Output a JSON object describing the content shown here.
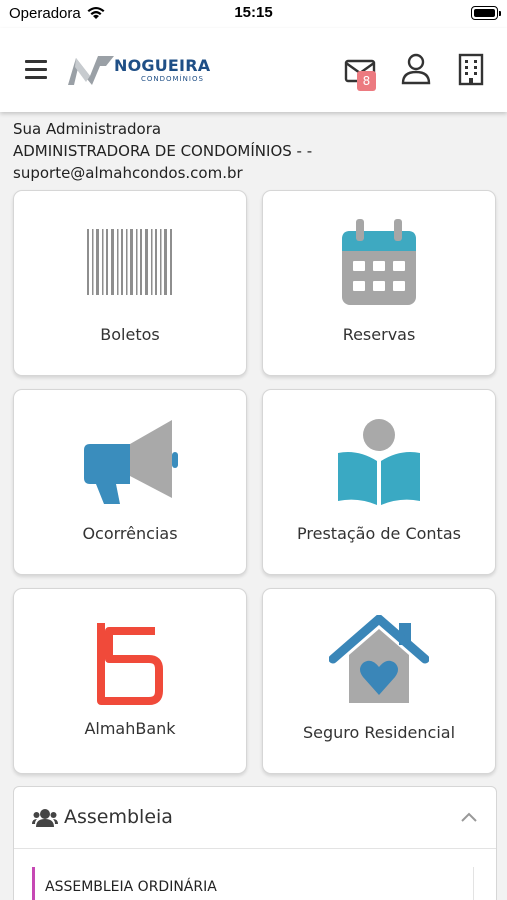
{
  "status_bar": {
    "carrier": "Operadora",
    "time": "15:15"
  },
  "header": {
    "logo_name": "NOGUEIRA",
    "logo_tagline": "CONDOMÍNIOS",
    "mail_badge_count": "8"
  },
  "admin": {
    "heading": "Sua Administradora",
    "name": "ADMINISTRADORA DE CONDOMÍNIOS - -",
    "email": "suporte@almahcondos.com.br"
  },
  "cards": [
    {
      "label": "Boletos",
      "icon": "barcode-icon"
    },
    {
      "label": "Reservas",
      "icon": "calendar-icon"
    },
    {
      "label": "Ocorrências",
      "icon": "megaphone-icon"
    },
    {
      "label": "Prestação de Contas",
      "icon": "book-reader-icon"
    },
    {
      "label": "AlmahBank",
      "icon": "almahbank-logo-icon"
    },
    {
      "label": "Seguro Residencial",
      "icon": "house-heart-icon"
    }
  ],
  "assembleia": {
    "title": "Assembleia",
    "items": [
      {
        "label": "ASSEMBLEIA ORDINÁRIA"
      }
    ]
  },
  "colors": {
    "brand_blue": "#1f4f86",
    "badge": "#ec7a80",
    "calendar_teal": "#3ea9c1",
    "megaphone_blue": "#3a8dbd",
    "book_teal": "#3aa9c3",
    "almahbank_red": "#f04a3a",
    "house_blue": "#3a86b8",
    "accent_pink": "#c648b4"
  }
}
